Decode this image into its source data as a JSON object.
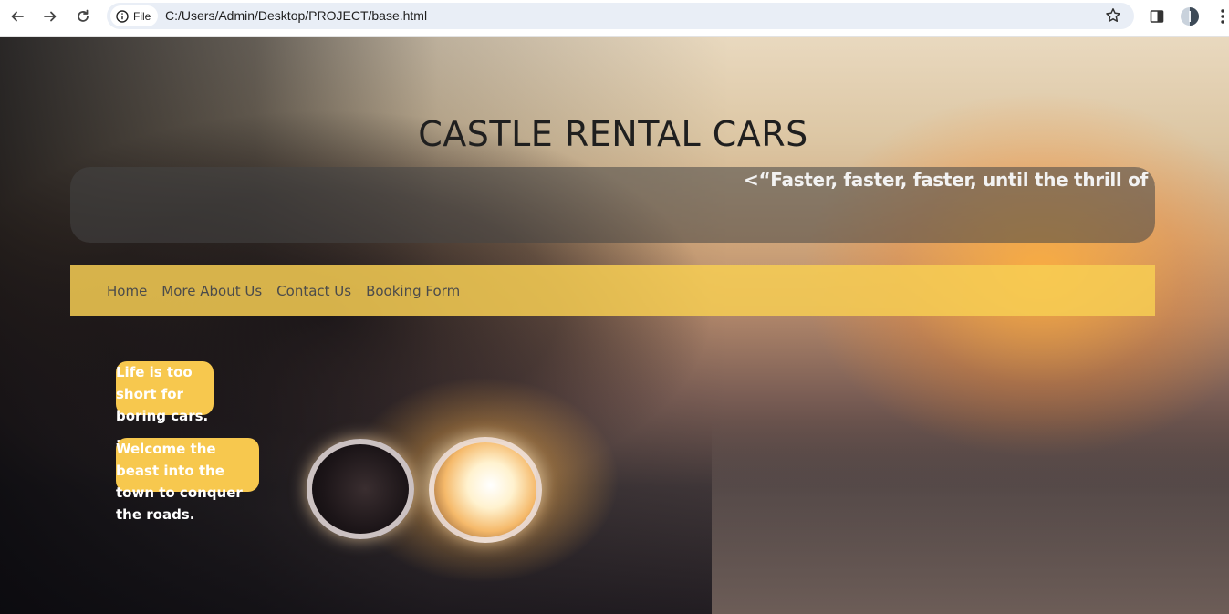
{
  "browser": {
    "site_chip_label": "File",
    "url": "C:/Users/Admin/Desktop/PROJECT/base.html"
  },
  "page": {
    "title": "CASTLE RENTAL CARS",
    "marquee_quote": "<“Faster, faster, faster, until the thrill of speed o",
    "nav": [
      "Home",
      "More About Us",
      "Contact Us",
      "Booking Form"
    ],
    "tagline_1": "Life is too short for boring cars. ...",
    "tagline_2": "Welcome the beast into the town to conquer the roads."
  },
  "colors": {
    "nav_bar": "#f7ce54",
    "tag_box": "#f7c84e",
    "quote_box": "#464646"
  },
  "icons": {
    "back": "back-arrow-icon",
    "forward": "forward-arrow-icon",
    "reload": "reload-icon",
    "info": "info-icon",
    "bookmark": "star-icon",
    "side_panel": "side-panel-icon",
    "profile": "profile-avatar-icon",
    "menu": "kebab-menu-icon"
  }
}
